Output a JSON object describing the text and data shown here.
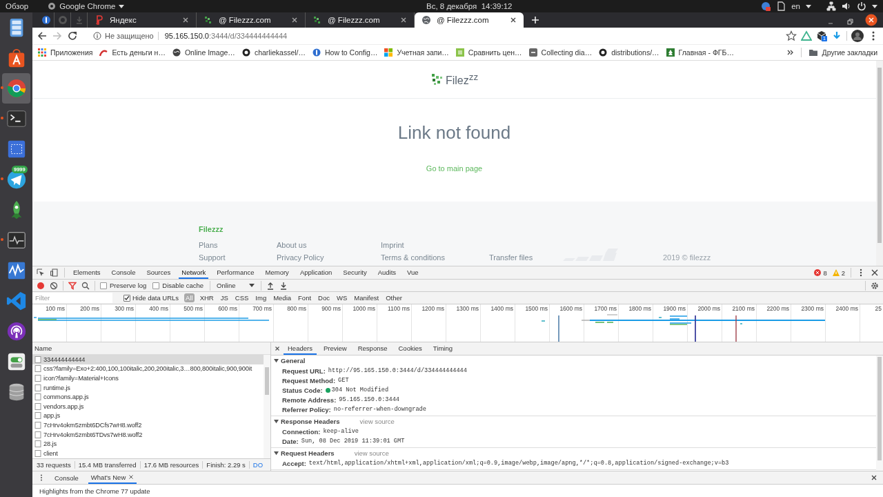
{
  "top_bar": {
    "activities": "Обзор",
    "app_menu": "Google Chrome",
    "clock": "Вс, 8 декабря  14:39:12",
    "language": "en"
  },
  "dock": [
    {
      "kind": "files",
      "selected": false,
      "running": false
    },
    {
      "kind": "software",
      "selected": false,
      "running": false
    },
    {
      "kind": "chrome",
      "selected": true,
      "running": true
    },
    {
      "kind": "terminal",
      "selected": false,
      "running": true
    },
    {
      "kind": "screenshot",
      "selected": false,
      "running": false
    },
    {
      "kind": "telegram",
      "selected": false,
      "running": true,
      "badge": "9999"
    },
    {
      "kind": "rocket",
      "selected": false,
      "running": false
    },
    {
      "kind": "monitor",
      "selected": false,
      "running": true
    },
    {
      "kind": "wave",
      "selected": false,
      "running": false
    },
    {
      "kind": "vscode",
      "selected": false,
      "running": false
    },
    {
      "kind": "podcast",
      "selected": false,
      "running": false
    },
    {
      "kind": "toggle",
      "selected": false,
      "running": false
    },
    {
      "kind": "database",
      "selected": false,
      "running": false
    }
  ],
  "browser": {
    "pinned_tabs": [
      {
        "kind": "info"
      },
      {
        "kind": "github"
      },
      {
        "kind": "download"
      }
    ],
    "tabs": [
      {
        "kind": "yandex",
        "title": "Яндекс",
        "selected": false
      },
      {
        "kind": "filezzz",
        "title": "@ Filezzz.com",
        "selected": false
      },
      {
        "kind": "filezzz",
        "title": "@ Filezzz.com",
        "selected": false
      },
      {
        "kind": "globe",
        "title": "@ Filezzz.com",
        "selected": true
      }
    ],
    "security": "Не защищено",
    "url": "**95.165.150.0**:3444/d/334444444444",
    "extension_badge": "1",
    "bookmarks": [
      {
        "kind": "apps",
        "label": "Приложения"
      },
      {
        "kind": "arc",
        "label": "Есть деньги н…"
      },
      {
        "kind": "globe",
        "label": "Online Image…"
      },
      {
        "kind": "github",
        "label": "charliekassel/…"
      },
      {
        "kind": "shield",
        "label": "How to Config…"
      },
      {
        "kind": "windows",
        "label": "Учетная запи…"
      },
      {
        "kind": "hp",
        "label": "Сравнить цен…"
      },
      {
        "kind": "vm",
        "label": "Collecting dia…"
      },
      {
        "kind": "github",
        "label": "distributions/…"
      },
      {
        "kind": "tree",
        "label": "Главная - ФГБ…"
      }
    ],
    "other_bookmarks": "Другие закладки"
  },
  "page": {
    "logo": "Filez$^{zz}$",
    "title": "Link not found",
    "link": "Go to main page",
    "footer": {
      "brand": "Filezzz",
      "columns": [
        [
          "Plans",
          "Support"
        ],
        [
          "About us",
          "Privacy Policy"
        ],
        [
          "Imprint",
          "Terms & conditions"
        ]
      ],
      "transfer_link": "Transfer files",
      "copyright": "2019 © filezzz"
    }
  },
  "devtools": {
    "tabs": [
      {
        "label": "Elements",
        "selected": false
      },
      {
        "label": "Console",
        "selected": false
      },
      {
        "label": "Sources",
        "selected": false
      },
      {
        "label": "Network",
        "selected": true
      },
      {
        "label": "Performance",
        "selected": false
      },
      {
        "label": "Memory",
        "selected": false
      },
      {
        "label": "Application",
        "selected": false
      },
      {
        "label": "Security",
        "selected": false
      },
      {
        "label": "Audits",
        "selected": false
      },
      {
        "label": "Vue",
        "selected": false
      }
    ],
    "errors": "8",
    "warnings": "2",
    "preserve_log": false,
    "preserve_log_label": "Preserve log",
    "disable_cache": false,
    "disable_cache_label": "Disable cache",
    "throttling": "Online",
    "filter_placeholder": "Filter",
    "hide_data_urls": true,
    "hide_data_urls_label": "Hide data URLs",
    "types": [
      {
        "label": "All",
        "selected": true
      },
      {
        "label": "XHR",
        "selected": false
      },
      {
        "label": "JS",
        "selected": false
      },
      {
        "label": "CSS",
        "selected": false
      },
      {
        "label": "Img",
        "selected": false
      },
      {
        "label": "Media",
        "selected": false
      },
      {
        "label": "Font",
        "selected": false
      },
      {
        "label": "Doc",
        "selected": false
      },
      {
        "label": "WS",
        "selected": false
      },
      {
        "label": "Manifest",
        "selected": false
      },
      {
        "label": "Other",
        "selected": false
      }
    ],
    "ticks": [
      "100 ms",
      "200 ms",
      "300 ms",
      "400 ms",
      "500 ms",
      "600 ms",
      "700 ms",
      "800 ms",
      "900 ms",
      "1000 ms",
      "1100 ms",
      "1200 ms",
      "1300 ms",
      "1400 ms",
      "1500 ms",
      "1600 ms",
      "1700 ms",
      "1800 ms",
      "1900 ms",
      "2000 ms",
      "2100 ms",
      "2200 ms",
      "2300 ms",
      "2400 ms",
      "25"
    ],
    "name_header": "Name",
    "requests": [
      {
        "name": "334444444444",
        "selected": true
      },
      {
        "name": "css?family=Exo+2:400,100,100italic,200,200italic,3…800,800italic,900,900it",
        "selected": false
      },
      {
        "name": "icon?family=Material+Icons",
        "selected": false
      },
      {
        "name": "runtime.js",
        "selected": false
      },
      {
        "name": "commons.app.js",
        "selected": false
      },
      {
        "name": "vendors.app.js",
        "selected": false
      },
      {
        "name": "app.js",
        "selected": false
      },
      {
        "name": "7cHrv4okm5zmbt6DCfs7wH8.woff2",
        "selected": false
      },
      {
        "name": "7cHrv4okm5zmbt6TDvs7wH8.woff2",
        "selected": false
      },
      {
        "name": "28.js",
        "selected": false
      },
      {
        "name": "client",
        "selected": false
      }
    ],
    "summary": [
      "33 requests",
      "15.4 MB transferred",
      "17.6 MB resources",
      "Finish: 2.29 s",
      "DO"
    ],
    "detail_tabs": [
      {
        "label": "Headers",
        "selected": true
      },
      {
        "label": "Preview",
        "selected": false
      },
      {
        "label": "Response",
        "selected": false
      },
      {
        "label": "Cookies",
        "selected": false
      },
      {
        "label": "Timing",
        "selected": false
      }
    ],
    "sections": [
      {
        "title": "General",
        "expanded": true,
        "rows": [
          {
            "kind": "text",
            "label": "Request URL:",
            "value": "http://95.165.150.0:3444/d/334444444444"
          },
          {
            "kind": "text",
            "label": "Request Method:",
            "value": "GET"
          },
          {
            "kind": "status",
            "label": "Status Code:",
            "value": "304 Not Modified"
          },
          {
            "kind": "text",
            "label": "Remote Address:",
            "value": "95.165.150.0:3444"
          },
          {
            "kind": "text",
            "label": "Referrer Policy:",
            "value": "no-referrer-when-downgrade"
          }
        ]
      },
      {
        "title": "Response Headers",
        "expanded": true,
        "view_source": "view source",
        "rows": [
          {
            "kind": "text",
            "label": "Connection:",
            "value": "keep-alive"
          },
          {
            "kind": "text",
            "label": "Date:",
            "value": "Sun, 08 Dec 2019 11:39:01 GMT"
          }
        ]
      },
      {
        "title": "Request Headers",
        "expanded": true,
        "view_source": "view source",
        "rows": [
          {
            "kind": "text",
            "label": "Accept:",
            "value": "text/html,application/xhtml+xml,application/xml;q=0.9,image/webp,image/apng,*/*;q=0.8,application/signed-exchange;v=b3"
          }
        ]
      }
    ],
    "drawer_tabs": [
      {
        "label": "Console",
        "selected": false,
        "closable": false
      },
      {
        "label": "What's New",
        "selected": true,
        "closable": true
      }
    ],
    "drawer_text": "Highlights from the Chrome 77 update"
  }
}
